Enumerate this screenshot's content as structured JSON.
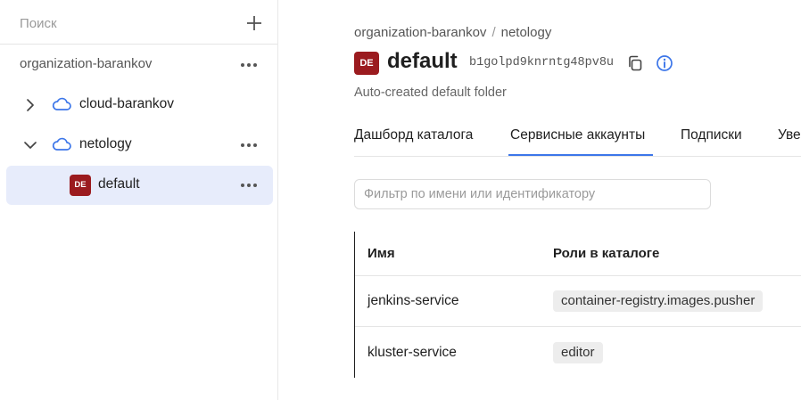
{
  "sidebar": {
    "search_placeholder": "Поиск",
    "organization": "organization-barankov",
    "items": [
      {
        "label": "cloud-barankov",
        "expanded": false
      },
      {
        "label": "netology",
        "expanded": true
      },
      {
        "label": "default",
        "badge": "DE",
        "selected": true
      }
    ]
  },
  "header": {
    "breadcrumb": [
      "organization-barankov",
      "netology"
    ],
    "breadcrumb_separator": "/",
    "badge": "DE",
    "title": "default",
    "folder_id": "b1golpd9knrntg48pv8u",
    "subtitle": "Auto-created default folder"
  },
  "tabs": [
    {
      "label": "Дашборд каталога",
      "active": false
    },
    {
      "label": "Сервисные аккаунты",
      "active": true
    },
    {
      "label": "Подписки",
      "active": false
    },
    {
      "label": "Уве",
      "active": false
    }
  ],
  "filter": {
    "placeholder": "Фильтр по имени или идентификатору",
    "value": ""
  },
  "table": {
    "columns": [
      "Имя",
      "Роли в каталоге"
    ],
    "rows": [
      {
        "name": "jenkins-service",
        "role": "container-registry.images.pusher"
      },
      {
        "name": "kluster-service",
        "role": "editor"
      }
    ]
  },
  "colors": {
    "badge_bg": "#9b1b1f",
    "selected_bg": "#e7ecfb",
    "accent": "#3c76e9",
    "chip_bg": "#ededed"
  },
  "icons": [
    "plus-icon",
    "more-dots-icon",
    "chevron-right-icon",
    "chevron-down-icon",
    "cloud-icon",
    "copy-icon",
    "info-icon"
  ]
}
